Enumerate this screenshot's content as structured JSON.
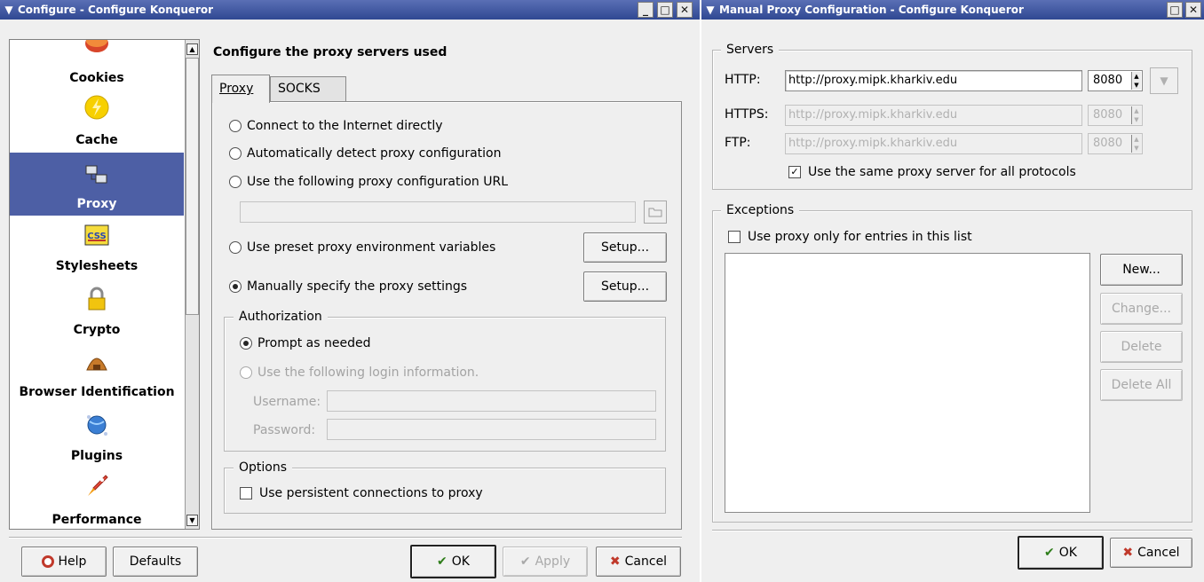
{
  "colors": {
    "titlebar": "#3a53a0",
    "selection": "#4d5fa5",
    "background": "#efefef"
  },
  "left_window": {
    "title": "Configure - Configure Konqueror",
    "sidebar": {
      "items": [
        {
          "label": "Cookies",
          "icon": "cookie-icon"
        },
        {
          "label": "Cache",
          "icon": "cache-lightning-icon"
        },
        {
          "label": "Proxy",
          "icon": "proxy-computers-icon",
          "selected": true
        },
        {
          "label": "Stylesheets",
          "icon": "css-icon"
        },
        {
          "label": "Crypto",
          "icon": "padlock-icon"
        },
        {
          "label": "Browser Identification",
          "icon": "browser-id-icon"
        },
        {
          "label": "Plugins",
          "icon": "plugins-globe-icon"
        },
        {
          "label": "Performance",
          "icon": "rocket-icon"
        }
      ]
    },
    "heading": "Configure the proxy servers used",
    "tabs": [
      "Proxy",
      "SOCKS"
    ],
    "options": {
      "direct": "Connect to the Internet directly",
      "auto_detect": "Automatically detect proxy configuration",
      "use_url": "Use the following proxy configuration URL",
      "env_vars": "Use preset proxy environment variables",
      "manual": "Manually specify the proxy settings",
      "setup_label": "Setup...",
      "url_value": ""
    },
    "authorization": {
      "title": "Authorization",
      "prompt": "Prompt as needed",
      "use_login": "Use the following login information.",
      "username_label": "Username:",
      "password_label": "Password:",
      "username_value": "",
      "password_value": ""
    },
    "options_group": {
      "title": "Options",
      "persistent": "Use persistent connections to proxy"
    },
    "buttons": {
      "help": "Help",
      "defaults": "Defaults",
      "ok": "OK",
      "apply": "Apply",
      "cancel": "Cancel"
    }
  },
  "right_window": {
    "title": "Manual Proxy Configuration - Configure Konqueror",
    "servers": {
      "title": "Servers",
      "http_label": "HTTP:",
      "https_label": "HTTPS:",
      "ftp_label": "FTP:",
      "http_value": "http://proxy.mipk.kharkiv.edu",
      "https_value": "http://proxy.mipk.kharkiv.edu",
      "ftp_value": "http://proxy.mipk.kharkiv.edu",
      "http_port": "8080",
      "https_port": "8080",
      "ftp_port": "8080",
      "same_proxy": "Use the same proxy server for all protocols"
    },
    "exceptions": {
      "title": "Exceptions",
      "only_list": "Use proxy only for entries in this list",
      "new": "New...",
      "change": "Change...",
      "delete": "Delete",
      "delete_all": "Delete All"
    },
    "buttons": {
      "ok": "OK",
      "cancel": "Cancel"
    }
  }
}
